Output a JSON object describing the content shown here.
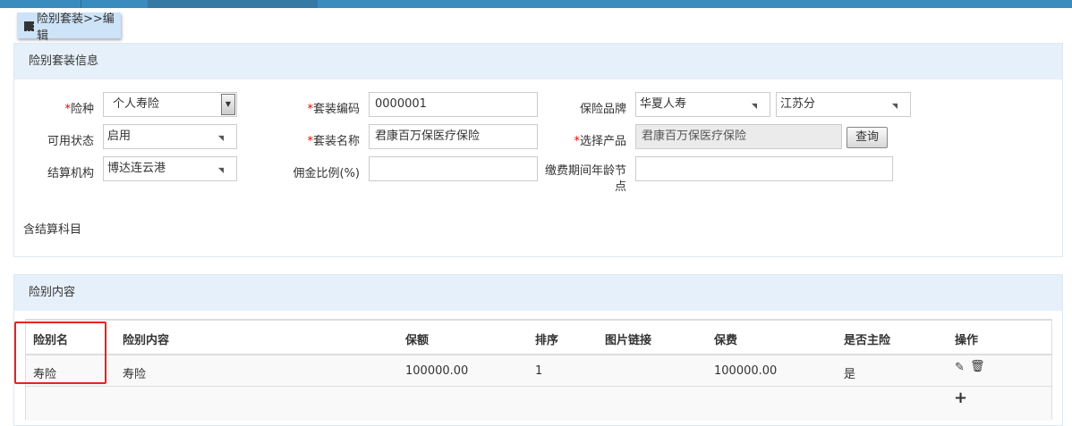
{
  "breadcrumb": "险别套装>>编辑",
  "section1": {
    "title": "险别套装信息",
    "fields": {
      "insurance_type": {
        "label": "险种",
        "value": "个人寿险",
        "required": true
      },
      "status": {
        "label": "可用状态",
        "value": "启用"
      },
      "settle_org": {
        "label": "结算机构",
        "value": "博达连云港"
      },
      "package_code": {
        "label": "套装编码",
        "value": "0000001",
        "required": true
      },
      "package_name": {
        "label": "套装名称",
        "value": "君康百万保医疗保险",
        "required": true
      },
      "commission": {
        "label": "佣金比例(%)",
        "value": ""
      },
      "brand": {
        "label": "保险品牌",
        "value": "华夏人寿",
        "branch": "江苏分"
      },
      "product": {
        "label": "选择产品",
        "value": "君康百万保医疗保险",
        "required": true,
        "button": "查询"
      },
      "age_node": {
        "label": "缴费期间年龄节点",
        "value": ""
      }
    },
    "settle_subject_label": "含结算科目"
  },
  "section2": {
    "title": "险别内容",
    "columns": [
      "险别名",
      "险别内容",
      "保额",
      "排序",
      "图片链接",
      "保费",
      "是否主险",
      "操作"
    ],
    "rows": [
      [
        "寿险",
        "寿险",
        "100000.00",
        "1",
        "",
        "100000.00",
        "是"
      ]
    ]
  },
  "required_mark": "*"
}
